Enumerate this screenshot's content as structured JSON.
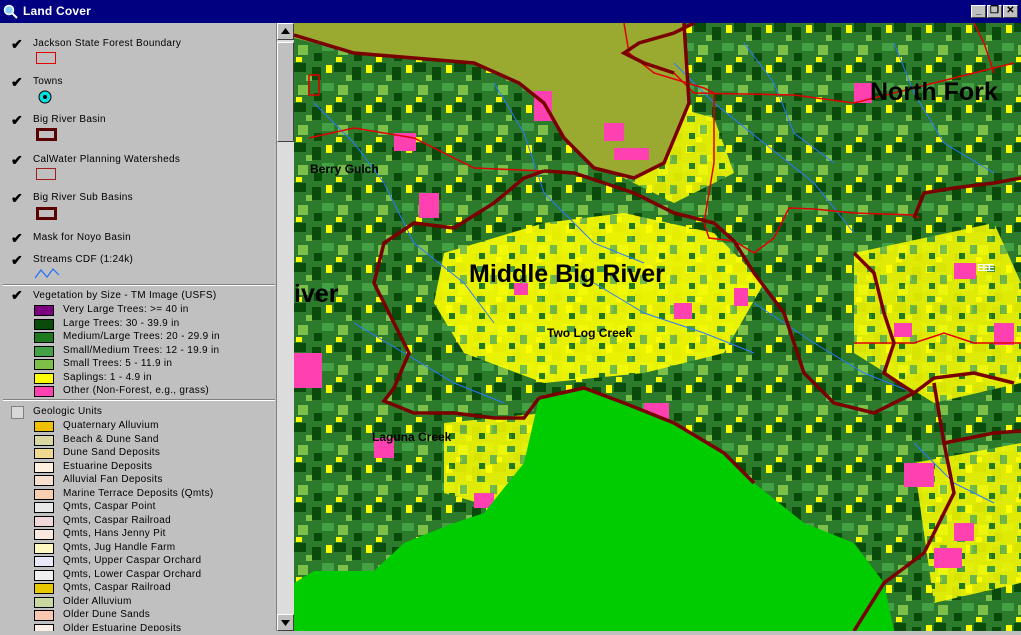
{
  "window": {
    "title": "Land Cover",
    "minimize_glyph": "_",
    "maximize_glyph": "❐",
    "close_glyph": "✕"
  },
  "colors": {
    "titlebar": "#000080",
    "panel": "#c0c0c0",
    "boundary_red": "#e00000",
    "basin_maroon": "#7a0000",
    "ocean_green": "#00cc00",
    "grass_olive": "#9aaa30"
  },
  "layers": [
    {
      "label": "Jackson State Forest Boundary",
      "checked": true,
      "symbol": "red-rectangle-outline"
    },
    {
      "label": "Towns",
      "checked": true,
      "symbol": "town-point-icon"
    },
    {
      "label": "Big River Basin",
      "checked": true,
      "symbol": "maroon-thick-rectangle"
    },
    {
      "label": "CalWater Planning Watersheds",
      "checked": true,
      "symbol": "brown-rectangle-outline"
    },
    {
      "label": "Big River Sub Basins",
      "checked": true,
      "symbol": "maroon-thick-rectangle"
    },
    {
      "label": "Mask for Noyo Basin",
      "checked": true,
      "symbol": "none"
    },
    {
      "label": "Streams CDF (1:24k)",
      "checked": true,
      "symbol": "stream-line-icon"
    }
  ],
  "vegetation": {
    "label": "Vegetation by Size - TM Image (USFS)",
    "checked": true,
    "classes": [
      {
        "label": "Very Large Trees: >= 40  in",
        "color": "#7b0080"
      },
      {
        "label": "Large Trees: 30 - 39.9 in",
        "color": "#0a4a0a"
      },
      {
        "label": "Medium/Large Trees: 20 - 29.9 in",
        "color": "#1e7a1e"
      },
      {
        "label": "Small/Medium Trees: 12 - 19.9 in",
        "color": "#44a044"
      },
      {
        "label": "Small Trees: 5 - 11.9 in",
        "color": "#7cc04a"
      },
      {
        "label": "Saplings: 1 - 4.9 in",
        "color": "#ffff00"
      },
      {
        "label": "Other (Non-Forest, e.g., grass)",
        "color": "#ff40b0"
      }
    ]
  },
  "geologic": {
    "label": "Geologic Units",
    "checked": false,
    "classes": [
      {
        "label": "Quaternary Alluvium",
        "color": "#f0c000"
      },
      {
        "label": "Beach & Dune Sand",
        "color": "#d8d8a0"
      },
      {
        "label": "Dune Sand Deposits",
        "color": "#f0d890"
      },
      {
        "label": "Estuarine Deposits",
        "color": "#fff0e0"
      },
      {
        "label": "Alluvial Fan Deposits",
        "color": "#f8e0d0"
      },
      {
        "label": "Marine Terrace Deposits (Qmts)",
        "color": "#f8d0b0"
      },
      {
        "label": "Qmts, Caspar Point",
        "color": "#e8e8e8"
      },
      {
        "label": "Qmts, Caspar Railroad",
        "color": "#f0d8d8"
      },
      {
        "label": "Qmts, Hans Jenny Pit",
        "color": "#f8e8e0"
      },
      {
        "label": "Qmts, Jug Handle Farm",
        "color": "#fff8c0"
      },
      {
        "label": "Qmts, Upper Caspar Orchard",
        "color": "#e8e8f8"
      },
      {
        "label": "Qmts, Lower Caspar Orchard",
        "color": "#f0f0f0"
      },
      {
        "label": "Qmts, Caspar Railroad",
        "color": "#e8c800"
      },
      {
        "label": "Older Alluvium",
        "color": "#c8d8a0"
      },
      {
        "label": "Older Dune Sands",
        "color": "#f8c8b0"
      },
      {
        "label": "Older Estuarine Deposits",
        "color": "#fff0e8"
      }
    ]
  },
  "map": {
    "labels": {
      "north_fork": "North Fork",
      "berry_gulch": "Berry Gulch",
      "middle_big_river": "Middle Big River",
      "river": "iver",
      "two_log_creek": "Two Log Creek",
      "laguna_creek": "Laguna Creek",
      "edge_text": "E E E"
    }
  }
}
